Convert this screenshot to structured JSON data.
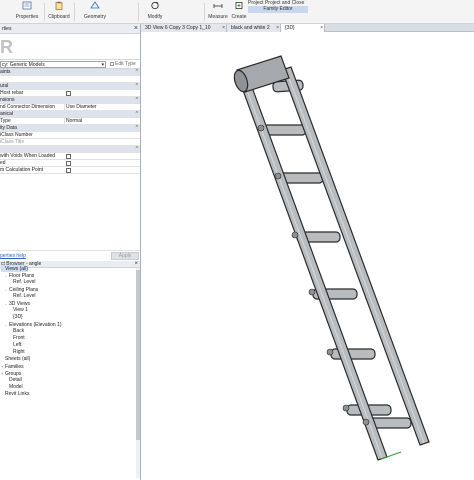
{
  "ribbon": {
    "buttons": [
      {
        "label": "Properties",
        "icon": "properties-icon"
      },
      {
        "label": "Clipboard",
        "icon": "clipboard-icon"
      },
      {
        "label": "Geometry",
        "icon": "geometry-icon"
      },
      {
        "label": "Modify",
        "icon": "modify-icon"
      },
      {
        "label": "Measure",
        "icon": "measure-icon"
      },
      {
        "label": "Create",
        "icon": "create-icon"
      }
    ],
    "context_top": "Project   Project and Close",
    "family_editor": "Family Editor"
  },
  "properties": {
    "title": "rties",
    "type_filter": "cy: Generic Models",
    "edit_type": "Edit Type",
    "rows": [
      {
        "cat": true,
        "k": "aints",
        "v": ""
      },
      {
        "cat": false,
        "k": "",
        "v": ""
      },
      {
        "cat": true,
        "k": "ural",
        "v": ""
      },
      {
        "cat": false,
        "k": "Host rebar",
        "v": "",
        "checkbox": true
      },
      {
        "cat": true,
        "k": "nsions",
        "v": ""
      },
      {
        "cat": false,
        "k": "nd Connector Dimension",
        "v": "Use Diameter"
      },
      {
        "cat": true,
        "k": "anical",
        "v": ""
      },
      {
        "cat": false,
        "k": "Type",
        "v": "Normal"
      },
      {
        "cat": true,
        "k": "ity Data",
        "v": ""
      },
      {
        "cat": false,
        "k": "iClass Number",
        "v": ""
      },
      {
        "cat": false,
        "k": "iClass Title",
        "v": "",
        "grey": true
      },
      {
        "cat": true,
        "k": "",
        "v": ""
      },
      {
        "cat": false,
        "k": "with Voids When Loaded",
        "v": "",
        "checkbox": true
      },
      {
        "cat": false,
        "k": "ed",
        "v": "",
        "checkbox": true
      },
      {
        "cat": false,
        "k": "m Calculation Point",
        "v": "",
        "checkbox": true
      }
    ],
    "help": "perties help",
    "apply": "Apply"
  },
  "browser": {
    "title": "ct Browser - angle",
    "nodes": [
      {
        "label": "Views (all)",
        "indent": 0,
        "tw": "-",
        "sel": true
      },
      {
        "label": "Floor Plans",
        "indent": 1,
        "tw": "-"
      },
      {
        "label": "Ref. Level",
        "indent": 2,
        "tw": ""
      },
      {
        "label": "Ceiling Plans",
        "indent": 1,
        "tw": "-"
      },
      {
        "label": "Ref. Level",
        "indent": 2,
        "tw": ""
      },
      {
        "label": "3D Views",
        "indent": 1,
        "tw": "-"
      },
      {
        "label": "View 1",
        "indent": 2,
        "tw": ""
      },
      {
        "label": "{3D}",
        "indent": 2,
        "tw": ""
      },
      {
        "label": "Elevations (Elevation 1)",
        "indent": 1,
        "tw": "-"
      },
      {
        "label": "Back",
        "indent": 2,
        "tw": ""
      },
      {
        "label": "Front",
        "indent": 2,
        "tw": ""
      },
      {
        "label": "Left",
        "indent": 2,
        "tw": ""
      },
      {
        "label": "Right",
        "indent": 2,
        "tw": ""
      },
      {
        "label": "Sheets (all)",
        "indent": 0,
        "tw": ""
      },
      {
        "label": "Families",
        "indent": 0,
        "tw": "+"
      },
      {
        "label": "Groups",
        "indent": 0,
        "tw": "+"
      },
      {
        "label": "Detail",
        "indent": 1,
        "tw": ""
      },
      {
        "label": "Model",
        "indent": 1,
        "tw": ""
      },
      {
        "label": "Revit Links",
        "indent": 0,
        "tw": ""
      }
    ]
  },
  "tabs": [
    {
      "label": "3D View 6 Copy 3 Copy 1_10",
      "active": false
    },
    {
      "label": "black and white 2",
      "active": false
    },
    {
      "label": "{3D}",
      "active": true
    }
  ],
  "colors": {
    "ladder_fill": "#b9bcbf",
    "ladder_edge": "#2b2b2b",
    "family_editor_bg": "#c9d6ee",
    "link": "#2b67c1"
  }
}
